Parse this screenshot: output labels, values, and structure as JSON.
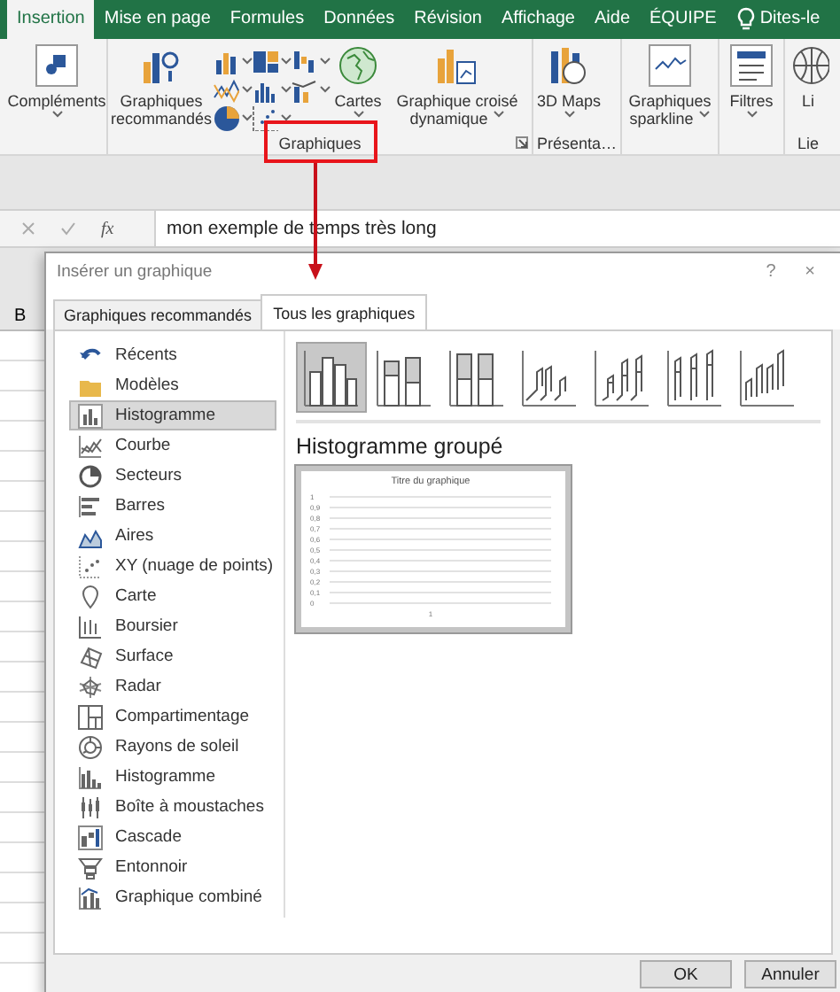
{
  "ribbon_tabs": [
    {
      "label": "Insertion",
      "selected": true
    },
    {
      "label": "Mise en page",
      "selected": false
    },
    {
      "label": "Formules",
      "selected": false
    },
    {
      "label": "Données",
      "selected": false
    },
    {
      "label": "Révision",
      "selected": false
    },
    {
      "label": "Affichage",
      "selected": false
    },
    {
      "label": "Aide",
      "selected": false
    },
    {
      "label": "ÉQUIPE",
      "selected": false
    }
  ],
  "tell_me": "Dites-le",
  "ribbon_groups": [
    {
      "commands": [
        {
          "kind": "large",
          "label": "Compléments",
          "dropdown": true
        }
      ]
    },
    {
      "label": "Graphiques",
      "launcher": true,
      "commands": [
        {
          "kind": "large",
          "label": "Graphiques recommandés",
          "dropdown": false
        },
        {
          "kind": "small",
          "dropdown": true
        },
        {
          "kind": "small",
          "dropdown": true
        },
        {
          "kind": "small",
          "dropdown": true
        },
        {
          "kind": "small",
          "dropdown": true
        },
        {
          "kind": "small",
          "dropdown": true
        },
        {
          "kind": "small",
          "dropdown": true
        },
        {
          "kind": "small",
          "dropdown": true
        },
        {
          "kind": "small",
          "dropdown": true
        },
        {
          "kind": "large",
          "label": "Cartes",
          "dropdown": true
        },
        {
          "kind": "large",
          "label": "Graphique croisé dynamique",
          "dropdown": true
        }
      ]
    },
    {
      "label": "Présenta…",
      "commands": [
        {
          "kind": "large",
          "label": "3D Maps",
          "dropdown": true
        }
      ]
    },
    {
      "commands": [
        {
          "kind": "large",
          "label": "Graphiques sparkline",
          "dropdown": true
        }
      ]
    },
    {
      "commands": [
        {
          "kind": "large",
          "label": "Filtres",
          "dropdown": true
        }
      ]
    },
    {
      "label": "Lie",
      "commands": [
        {
          "kind": "large",
          "label": "Li",
          "dropdown": false
        }
      ]
    }
  ],
  "formula_bar": {
    "function_label": "fx",
    "value": "mon exemple de temps très long"
  },
  "sheet": {
    "column_header": "B"
  },
  "dialog": {
    "title": "Insérer un graphique",
    "help": "?",
    "close": "×",
    "tabs": [
      {
        "label": "Graphiques recommandés",
        "selected": false
      },
      {
        "label": "Tous les graphiques",
        "selected": true
      }
    ],
    "categories": [
      {
        "label": "Récents",
        "selected": false
      },
      {
        "label": "Modèles",
        "selected": false
      },
      {
        "label": "Histogramme",
        "selected": true
      },
      {
        "label": "Courbe",
        "selected": false
      },
      {
        "label": "Secteurs",
        "selected": false
      },
      {
        "label": "Barres",
        "selected": false
      },
      {
        "label": "Aires",
        "selected": false
      },
      {
        "label": "XY (nuage de points)",
        "selected": false
      },
      {
        "label": "Carte",
        "selected": false
      },
      {
        "label": "Boursier",
        "selected": false
      },
      {
        "label": "Surface",
        "selected": false
      },
      {
        "label": "Radar",
        "selected": false
      },
      {
        "label": "Compartimentage",
        "selected": false
      },
      {
        "label": "Rayons de soleil",
        "selected": false
      },
      {
        "label": "Histogramme",
        "selected": false
      },
      {
        "label": "Boîte à moustaches",
        "selected": false
      },
      {
        "label": "Cascade",
        "selected": false
      },
      {
        "label": "Entonnoir",
        "selected": false
      },
      {
        "label": "Graphique combiné",
        "selected": false
      }
    ],
    "subtypes": [
      {
        "selected": true
      },
      {
        "selected": false
      },
      {
        "selected": false
      },
      {
        "selected": false
      },
      {
        "selected": false
      },
      {
        "selected": false
      },
      {
        "selected": false
      }
    ],
    "subtype_title": "Histogramme groupé",
    "preview": {
      "title": "Titre du graphique",
      "y_labels": [
        "1",
        "0,9",
        "0,8",
        "0,7",
        "0,6",
        "0,5",
        "0,4",
        "0,3",
        "0,2",
        "0,1",
        "0"
      ],
      "x_label": "1"
    },
    "buttons": [
      "OK",
      "Annuler"
    ]
  }
}
